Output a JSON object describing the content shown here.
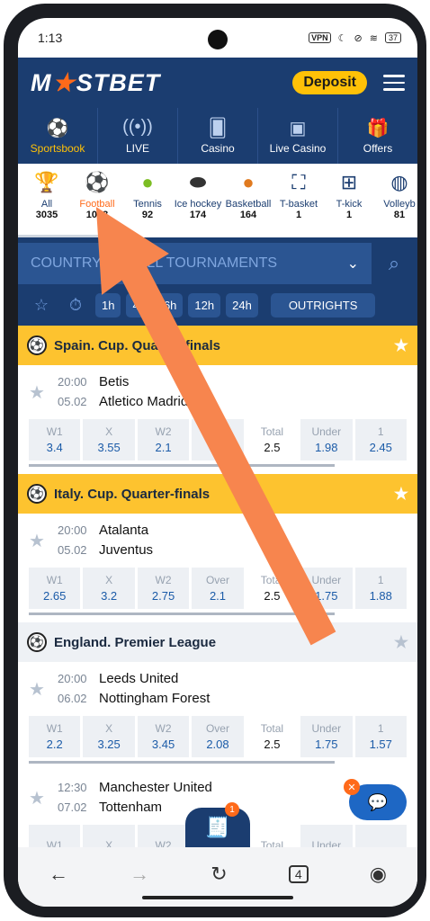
{
  "status": {
    "time": "1:13",
    "vpn": "VPN",
    "battery": "37"
  },
  "header": {
    "logo_left": "M",
    "logo_right": "STBET",
    "deposit_label": "Deposit",
    "nav": [
      {
        "label": "Sportsbook",
        "icon": "soccer-ball-icon"
      },
      {
        "label": "LIVE",
        "icon": "live-signal-icon"
      },
      {
        "label": "Casino",
        "icon": "casino-card-icon"
      },
      {
        "label": "Live Casino",
        "icon": "live-casino-icon"
      },
      {
        "label": "Offers",
        "icon": "gift-icon"
      }
    ]
  },
  "sports": [
    {
      "name": "All",
      "count": "3035",
      "icon": "trophy-icon"
    },
    {
      "name": "Football",
      "count": "1003",
      "icon": "football-icon"
    },
    {
      "name": "Tennis",
      "count": "92",
      "icon": "tennis-ball-icon"
    },
    {
      "name": "Ice hockey",
      "count": "174",
      "icon": "hockey-puck-icon"
    },
    {
      "name": "Basketball",
      "count": "164",
      "icon": "basketball-icon"
    },
    {
      "name": "T-basket",
      "count": "1",
      "icon": "t-basket-icon"
    },
    {
      "name": "T-kick",
      "count": "1",
      "icon": "t-kick-icon"
    },
    {
      "name": "Volleyb",
      "count": "81",
      "icon": "volleyball-icon"
    }
  ],
  "filters": {
    "country": "COUNTRY",
    "tournaments": "ALL TOURNAMENTS",
    "time_chips": [
      "1h",
      "4h",
      "6h",
      "12h",
      "24h"
    ],
    "outrights": "OUTRIGHTS"
  },
  "leagues": [
    {
      "title": "Spain. Cup. Quarter-finals",
      "style": "yellow",
      "match": {
        "time": "20:00",
        "date": "05.02",
        "home": "Betis",
        "away": "Atletico Madrid",
        "odds": [
          {
            "label": "W1",
            "value": "3.4"
          },
          {
            "label": "X",
            "value": "3.55"
          },
          {
            "label": "W2",
            "value": "2.1"
          },
          {
            "label": "Over",
            "value": "1.8"
          },
          {
            "label": "Total",
            "value": "2.5"
          },
          {
            "label": "Under",
            "value": "1.98"
          },
          {
            "label": "1",
            "value": "2.45"
          }
        ]
      }
    },
    {
      "title": "Italy. Cup. Quarter-finals",
      "style": "yellow",
      "match": {
        "time": "20:00",
        "date": "05.02",
        "home": "Atalanta",
        "away": "Juventus",
        "odds": [
          {
            "label": "W1",
            "value": "2.65"
          },
          {
            "label": "X",
            "value": "3.2"
          },
          {
            "label": "W2",
            "value": "2.75"
          },
          {
            "label": "Over",
            "value": "2.1"
          },
          {
            "label": "Total",
            "value": "2.5"
          },
          {
            "label": "Under",
            "value": "1.75"
          },
          {
            "label": "1",
            "value": "1.88"
          }
        ]
      }
    },
    {
      "title": "England. Premier League",
      "style": "gray",
      "match": {
        "time": "20:00",
        "date": "06.02",
        "home": "Leeds United",
        "away": "Nottingham Forest",
        "odds": [
          {
            "label": "W1",
            "value": "2.2"
          },
          {
            "label": "X",
            "value": "3.25"
          },
          {
            "label": "W2",
            "value": "3.45"
          },
          {
            "label": "Over",
            "value": "2.08"
          },
          {
            "label": "Total",
            "value": "2.5"
          },
          {
            "label": "Under",
            "value": "1.75"
          },
          {
            "label": "1",
            "value": "1.57"
          }
        ]
      }
    }
  ],
  "extra_match": {
    "time": "12:30",
    "date": "07.02",
    "home": "Manchester United",
    "away": "Tottenham",
    "odds_labels": [
      "W1",
      "X",
      "W2",
      "Total",
      "Under"
    ]
  },
  "betslip_count": "1",
  "tab_count": "4",
  "colors": {
    "brand": "#1b3d70",
    "accent": "#ffc107",
    "orange": "#ff6a1a"
  }
}
